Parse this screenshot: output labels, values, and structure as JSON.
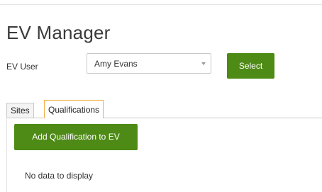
{
  "page": {
    "title": "EV Manager"
  },
  "ev_user": {
    "label": "EV User",
    "selected_value": "Amy Evans",
    "select_button_label": "Select"
  },
  "tabs": [
    {
      "label": "Sites",
      "active": false
    },
    {
      "label": "Qualifications",
      "active": true
    }
  ],
  "qualifications_panel": {
    "add_button_label": "Add Qualification to EV",
    "empty_message": "No data to display"
  },
  "colors": {
    "primary_button": "#4e8a16",
    "active_tab_border": "#f0b043"
  },
  "icons": {
    "user_select_toggle": "chevron-down-icon"
  }
}
